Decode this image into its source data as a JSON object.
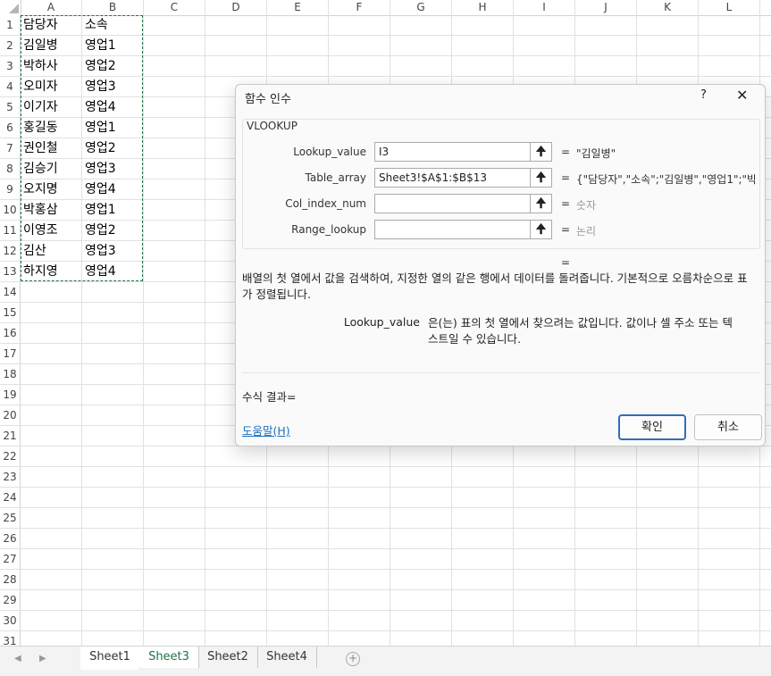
{
  "columns": [
    "A",
    "B",
    "C",
    "D",
    "E",
    "F",
    "G",
    "H",
    "I",
    "J",
    "K",
    "L"
  ],
  "rows": [
    "1",
    "2",
    "3",
    "4",
    "5",
    "6",
    "7",
    "8",
    "9",
    "10",
    "11",
    "12",
    "13",
    "14",
    "15",
    "16",
    "17",
    "18",
    "19",
    "20",
    "21",
    "22",
    "23",
    "24",
    "25",
    "26",
    "27",
    "28",
    "29",
    "30",
    "31"
  ],
  "cells": [
    [
      "담당자",
      "소속"
    ],
    [
      "김일병",
      "영업1"
    ],
    [
      "박하사",
      "영업2"
    ],
    [
      "오미자",
      "영업3"
    ],
    [
      "이기자",
      "영업4"
    ],
    [
      "홍길동",
      "영업1"
    ],
    [
      "권인철",
      "영업2"
    ],
    [
      "김승기",
      "영업3"
    ],
    [
      "오지명",
      "영업4"
    ],
    [
      "박홍삼",
      "영업1"
    ],
    [
      "이영조",
      "영업2"
    ],
    [
      "김산",
      "영업3"
    ],
    [
      "하지영",
      "영업4"
    ]
  ],
  "sheet_tabs": [
    "Sheet1",
    "Sheet3",
    "Sheet2",
    "Sheet4"
  ],
  "active_tab": "Sheet3",
  "dialog": {
    "title": "함수 인수",
    "help_icon": "?",
    "close_icon": "✕",
    "function_name": "VLOOKUP",
    "args": [
      {
        "label": "Lookup_value",
        "value": "I3",
        "equals": "=",
        "result": "\"김일병\"",
        "muted": false
      },
      {
        "label": "Table_array",
        "value": "Sheet3!$A$1:$B$13",
        "equals": "=",
        "result": "{\"담당자\",\"소속\";\"김일병\",\"영업1\";\"박ㅎ",
        "muted": false
      },
      {
        "label": "Col_index_num",
        "value": "",
        "equals": "=",
        "result": "숫자",
        "muted": true
      },
      {
        "label": "Range_lookup",
        "value": "",
        "equals": "=",
        "result": "논리",
        "muted": true
      }
    ],
    "overall_equals": "=",
    "description": "배열의 첫 열에서 값을 검색하여, 지정한 열의 같은 행에서 데이터를 돌려줍니다. 기본적으로 오름차순으로 표가 정렬됩니다.",
    "arg_desc_label": "Lookup_value",
    "arg_desc_text": "은(는) 표의 첫 열에서 찾으려는 값입니다. 값이나 셀 주소 또는 텍스트일 수 있습니다.",
    "formula_result_label": "수식 결과=",
    "help_link": "도움말(H)",
    "ok_label": "확인",
    "cancel_label": "취소"
  },
  "colors": {
    "accent": "#217346",
    "primary_button_border": "#2f6fb5",
    "link": "#1a6fc4"
  }
}
